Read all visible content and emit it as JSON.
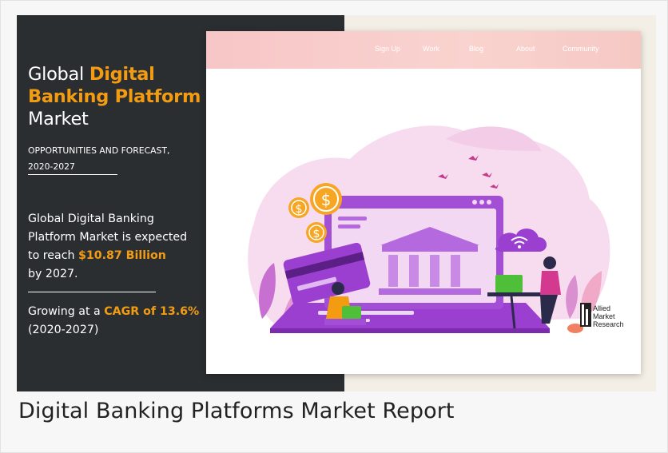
{
  "figure": {
    "headline": {
      "word1": "Global ",
      "word2": "Digital",
      "line2": "Banking Platform",
      "line3": "Market"
    },
    "subtitle": {
      "line1": "OPPORTUNITIES AND FORECAST,",
      "line2": "2020-2027"
    },
    "expectation": {
      "line1": "Global Digital Banking",
      "line2": "Platform Market is expected",
      "line3_prefix": "to reach ",
      "value": "$10.87 Billion",
      "line4": "by 2027."
    },
    "growth": {
      "prefix": "Growing at a ",
      "cagr": "CAGR of 13.6%",
      "period": "(2020-2027)"
    },
    "nav": [
      "Sign Up",
      "Work",
      "Blog",
      "About",
      "Community"
    ],
    "logo": {
      "line1": "Allied",
      "line2": "Market",
      "line3": "Research"
    },
    "colors": {
      "dark_panel": "#2b2e31",
      "accent_orange": "#f39c12",
      "nav_pink": "#f7c6c6",
      "illustration_purple": "#a24fd6"
    }
  },
  "caption": "Digital Banking Platforms Market Report"
}
